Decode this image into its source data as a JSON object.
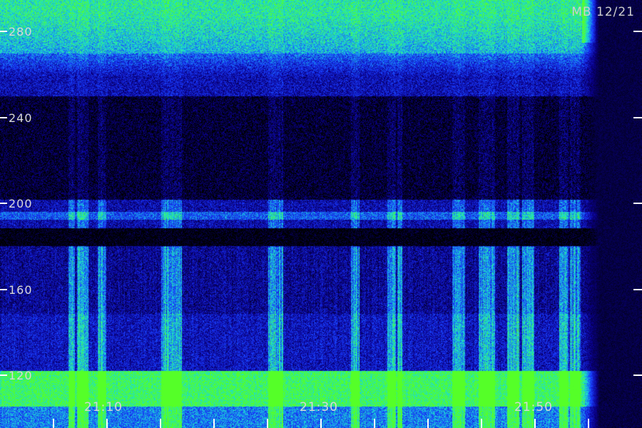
{
  "stamp": "MB 12/21",
  "y_axis": {
    "ticks": [
      {
        "label": "280",
        "value": 280
      },
      {
        "label": "240",
        "value": 240
      },
      {
        "label": "200",
        "value": 200
      },
      {
        "label": "160",
        "value": 160
      },
      {
        "label": "120",
        "value": 120
      }
    ],
    "range": [
      112,
      294
    ]
  },
  "x_axis": {
    "labels": [
      "21:10",
      "21:30",
      "21:50"
    ]
  },
  "colors": {
    "background": "#000000",
    "low": "#1a0a80",
    "mid": "#1a66ff",
    "high": "#19ffa0",
    "peak": "#4dff2a",
    "text": "#d8d8d8",
    "tick": "#ffffff"
  }
}
